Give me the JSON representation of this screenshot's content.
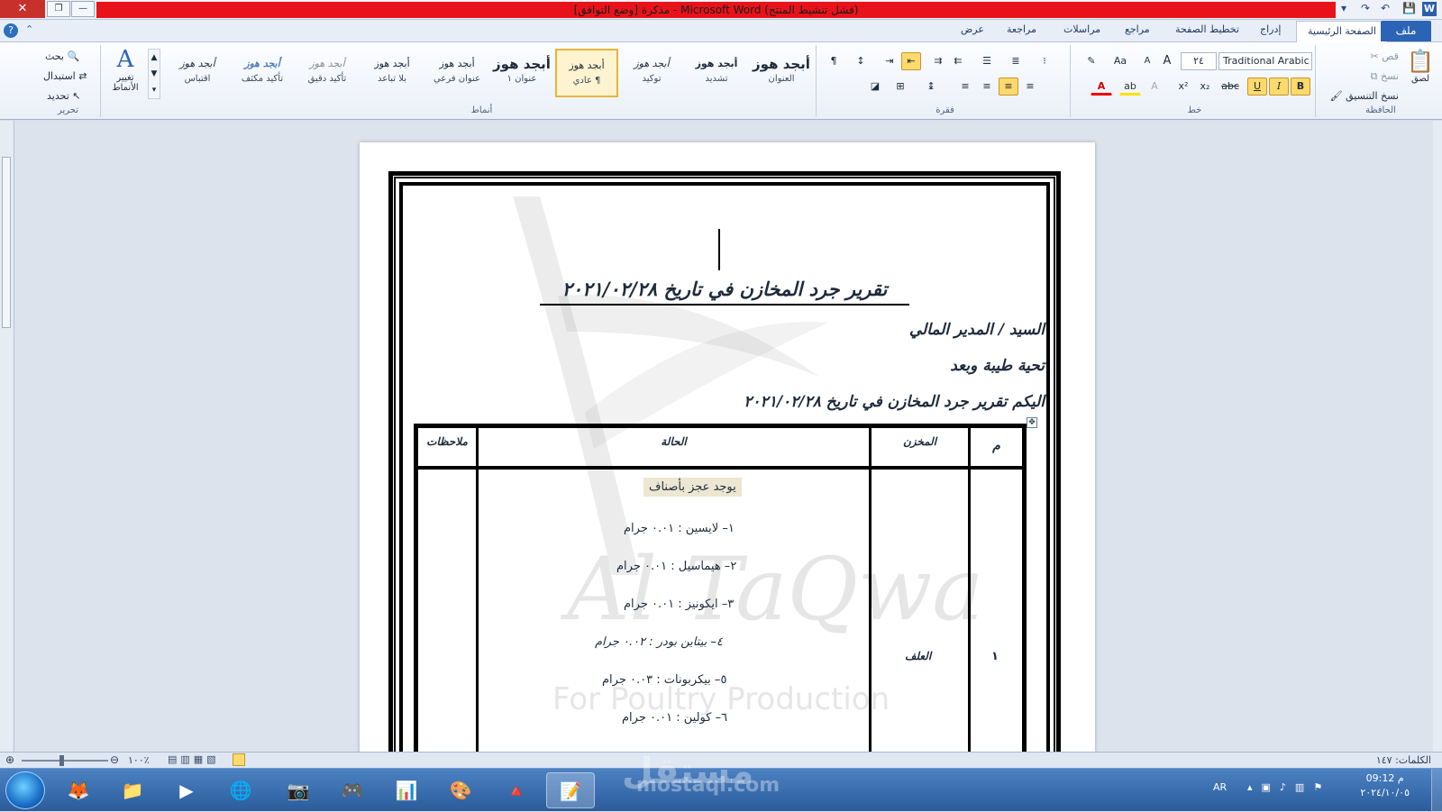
{
  "window": {
    "title": "مذكرة [وضع التوافق] - Microsoft Word (فشل تنشيط المنتج)",
    "close": "✕",
    "restore": "❐",
    "minimize": "—"
  },
  "qat": {
    "save": "💾",
    "undo": "↶",
    "redo": "↷",
    "customize": "▾"
  },
  "tabs": {
    "file": "ملف",
    "home": "الصفحة الرئيسية",
    "insert": "إدراج",
    "page_layout": "تخطيط الصفحة",
    "references": "مراجع",
    "mailings": "مراسلات",
    "review": "مراجعة",
    "view": "عرض"
  },
  "ribbon": {
    "clipboard": {
      "label": "الحافظة",
      "paste": "لصق",
      "cut": "قص",
      "copy": "نسخ",
      "format_painter": "نسخ التنسيق"
    },
    "font": {
      "label": "خط",
      "name": "Traditional Arabic",
      "size": "٢٤",
      "bold": "B",
      "italic": "I",
      "underline": "U",
      "strike": "abc",
      "sub": "x₂",
      "sup": "x²"
    },
    "paragraph": {
      "label": "فقرة",
      "pilcrow": "¶"
    },
    "styles": {
      "label": "أنماط",
      "change_styles": "تغيير الأنماط",
      "items": [
        {
          "sample": "أبجد هوز",
          "name": "العنوان"
        },
        {
          "sample": "أبجد هوز",
          "name": "تشديد"
        },
        {
          "sample": "أبجد هوز",
          "name": "توكيد"
        },
        {
          "sample": "أبجد هوز",
          "name": "¶ عادي"
        },
        {
          "sample": "أبجد هوز",
          "name": "عنوان ١"
        },
        {
          "sample": "أبجد هوز",
          "name": "عنوان فرعي"
        },
        {
          "sample": "أبجد هوز",
          "name": "بلا تباعد"
        },
        {
          "sample": "أبجد هوز",
          "name": "تأكيد دقيق"
        },
        {
          "sample": "أبجد هوز",
          "name": "تأكيد مكثف"
        },
        {
          "sample": "أبجد هوز",
          "name": "اقتباس"
        }
      ]
    },
    "editing": {
      "label": "تحرير",
      "find": "بحث",
      "replace": "استبدال",
      "select": "تحديد"
    }
  },
  "document": {
    "title": "تقرير جرد المخازن في تاريخ ٢٠٢١/٠٢/٢٨",
    "salutation": "السيد / المدير المالي",
    "greeting": "تحية طيبة وبعد",
    "intro": "اليكم تقرير جرد المخازن في تاريخ ٢٠٢١/٠٢/٢٨",
    "watermark": {
      "brand": "Al TaQwa",
      "sub": "For Poultry Production"
    },
    "table": {
      "headers": {
        "num": "م",
        "store": "المخزن",
        "status": "الحالة",
        "notes": "ملاحظات"
      },
      "row": {
        "num": "١",
        "store": "العلف",
        "status_heading": "يوجد عجز بأصناف",
        "items": [
          "١– لايسين : ٠.٠١ جرام",
          "٢– هيماسيل : ٠.٠١ جرام",
          "٣– ايكونيز : ٠.٠١ جرام",
          "٤– بيتاين بودر : ٠.٠٢ جرام",
          "٥– بيكربونات : ٠.٠٣ جرام",
          "٦– كولين : ٠.٠١ جرام"
        ]
      }
    }
  },
  "status": {
    "words": "الكلمات: ١٤٧",
    "zoom": "١٠٠٪"
  },
  "taskbar": {
    "lang": "AR",
    "time": "09:12 م",
    "date": "٢٠٢٤/١٠/٠٥"
  },
  "site_watermark": {
    "ar": "مستقل",
    "en": "mostaql.com"
  }
}
